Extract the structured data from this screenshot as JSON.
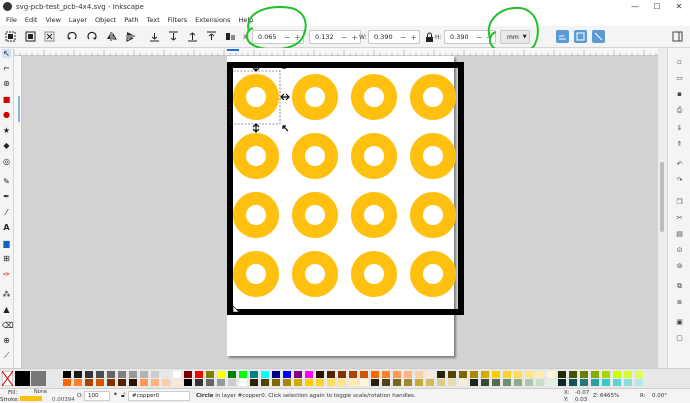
{
  "window": {
    "title": "svg-pcb-test_pcb-4x4.svg - Inkscape",
    "min": "—",
    "max": "☐",
    "close": "✕"
  },
  "menu": [
    "File",
    "Edit",
    "View",
    "Layer",
    "Object",
    "Path",
    "Text",
    "Filters",
    "Extensions",
    "Help"
  ],
  "toolbar": {
    "x_label": "X:",
    "x_value": "0.065",
    "y_value": "0.132",
    "w_label": "W:",
    "w_value": "0.390",
    "h_label": "H:",
    "h_value": "0.390",
    "unit": "mm",
    "minus": "−",
    "plus": "+"
  },
  "canvas": {
    "ring_color": "#FFC010",
    "rows": 4,
    "cols": 4
  },
  "palette": {
    "none_label": "None",
    "rows": [
      [
        "#000000",
        "#1a1a1a",
        "#333333",
        "#4d4d4d",
        "#666666",
        "#808080",
        "#999999",
        "#b3b3b3",
        "#cccccc",
        "#e6e6e6",
        "#ffffff",
        "#800000",
        "#ff0000",
        "#808000",
        "#ffff00",
        "#008000",
        "#00ff00",
        "#008080",
        "#00ffff",
        "#000080",
        "#0000ff",
        "#800080",
        "#ff00ff",
        "#2b1100",
        "#552200",
        "#803300",
        "#aa4400",
        "#d45500",
        "#ff6600",
        "#ff7f2a",
        "#ff9955",
        "#ffb380",
        "#ffccaa",
        "#ffe6d5",
        "#2b2200",
        "#554400",
        "#806600",
        "#aa8800",
        "#d4aa00",
        "#ffcc00",
        "#ffd42a",
        "#ffdd55",
        "#ffe680",
        "#ffeeaa",
        "#fff6d5",
        "#222b00",
        "#445500",
        "#668000",
        "#88aa00",
        "#aad400",
        "#ccff00",
        "#d4ff2a",
        "#ddff55"
      ],
      [
        "#ff6600",
        "#ff7f2a",
        "#aa4400",
        "#d45500",
        "#803300",
        "#552200",
        "#2b1100",
        "#ff9955",
        "#ffb380",
        "#ffccaa",
        "#ffe6d5",
        "#000000",
        "#333333",
        "#666666",
        "#999999",
        "#cccccc",
        "#ffffff",
        "#2b2200",
        "#554400",
        "#806600",
        "#aa8800",
        "#d4aa00",
        "#ffcc00",
        "#ffd42a",
        "#ffdd55",
        "#ffe680",
        "#ffeeaa",
        "#fff6d5",
        "#28220b",
        "#504416",
        "#786721",
        "#a0892c",
        "#c8ab37",
        "#d3bc5f",
        "#decd87",
        "#e9ddaf",
        "#f4eed7",
        "#1c241c",
        "#374837",
        "#536c53",
        "#6f916f",
        "#8dac8d",
        "#abc8ab",
        "#c9dec9",
        "#e3f0e3",
        "#0b2828",
        "#165050",
        "#217878",
        "#2ca0a0",
        "#37c8c8",
        "#5fd3d3",
        "#87dede",
        "#afe9e9"
      ]
    ]
  },
  "status": {
    "fill_label": "Fill:",
    "stroke_label": "Stroke:",
    "stroke_value": "0.00394",
    "opacity_label": "O:",
    "opacity_value": "100",
    "layer": "#copper0",
    "message_bold": "Circle",
    "message": " in layer #copper0. Click selection again to toggle scale/rotation handles.",
    "x_label": "X:",
    "x_value": "-0.07",
    "y_label": "Y:",
    "y_value": "0.03",
    "zoom_label": "Z:",
    "zoom_value": "6465%",
    "rot_label": "R:",
    "rot_value": "0.00°"
  }
}
